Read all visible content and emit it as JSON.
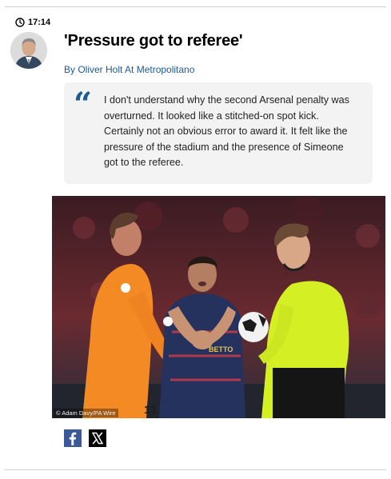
{
  "post": {
    "time": "17:14",
    "headline": "'Pressure got to referee'",
    "byline": "By Oliver Holt At Metropolitano",
    "quote": "I don't understand why the second Arsenal penalty was overturned. It looked like a stitched-on spot kick. Certainly not an obvious error to award it. It felt like the pressure of the stadium and the presence of Simeone got to the referee.",
    "quote_mark": "“",
    "photo_credit": "© Adam Davy/PA Wire"
  },
  "share": {
    "facebook_icon": "facebook-icon",
    "x_icon": "x-icon"
  },
  "colors": {
    "link_blue": "#1d5b94",
    "quote_bg": "#f3f3f3",
    "facebook": "#3b5998",
    "referee_kit": "#d4f024",
    "keeper_kit": "#ff8a1f"
  }
}
